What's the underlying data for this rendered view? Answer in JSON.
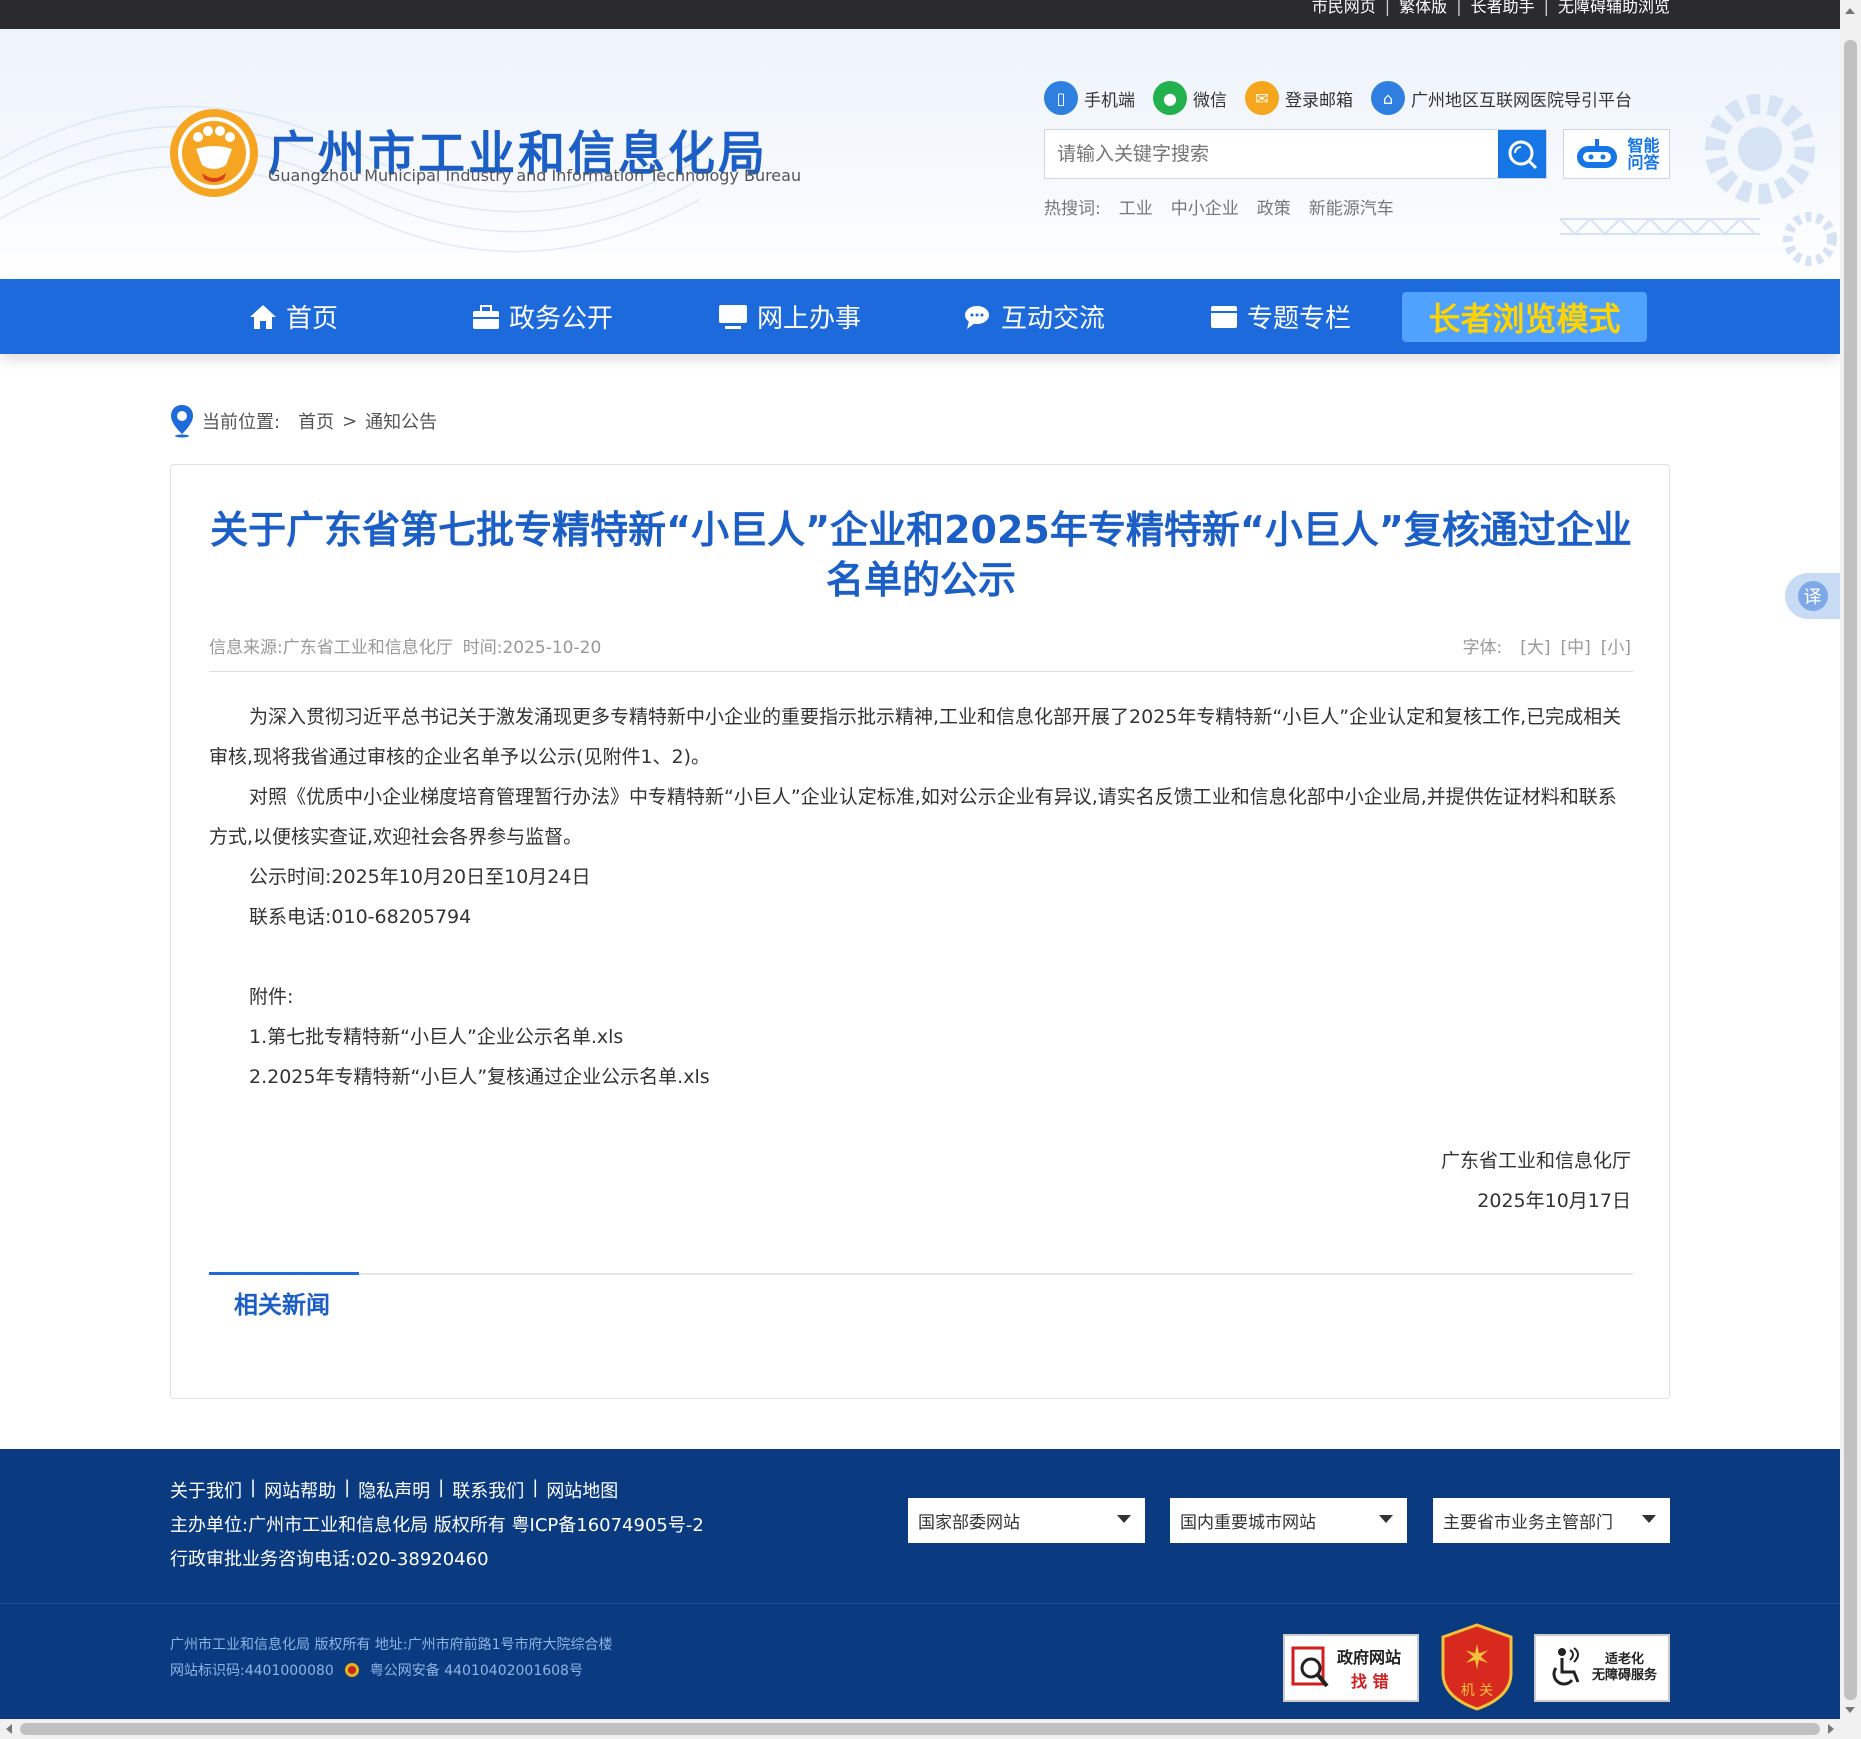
{
  "topbar": {
    "links": [
      "市民网页",
      "繁体版",
      "长者助手",
      "无障碍辅助浏览"
    ]
  },
  "header": {
    "title": "广州市工业和信息化局",
    "subtitle": "Guangzhou Municipal Industry and Information Technology Bureau",
    "quicklinks": [
      {
        "label": "手机端",
        "icon": "mobile-icon",
        "color": "#2e7fe0"
      },
      {
        "label": "微信",
        "icon": "wechat-icon",
        "color": "#23b14d"
      },
      {
        "label": "登录邮箱",
        "icon": "mail-icon",
        "color": "#f5a61c"
      },
      {
        "label": "广州地区互联网医院导引平台",
        "icon": "hospital-icon",
        "color": "#2e7fe0"
      }
    ],
    "search": {
      "placeholder": "请输入关键字搜索"
    },
    "robot": {
      "line1": "智能",
      "line2": "问答"
    },
    "hotwords_label": "热搜词:",
    "hotwords": [
      "工业",
      "中小企业",
      "政策",
      "新能源汽车"
    ]
  },
  "nav": {
    "items": [
      {
        "label": "首页",
        "icon": "home-icon"
      },
      {
        "label": "政务公开",
        "icon": "briefcase-icon"
      },
      {
        "label": "网上办事",
        "icon": "monitor-icon"
      },
      {
        "label": "互动交流",
        "icon": "chat-icon"
      },
      {
        "label": "专题专栏",
        "icon": "folder-icon"
      }
    ],
    "elder_mode": "长者浏览模式"
  },
  "breadcrumb": {
    "label": "当前位置:",
    "home": "首页",
    "sep": ">",
    "current": "通知公告"
  },
  "article": {
    "title": "关于广东省第七批专精特新“小巨人”企业和2025年专精特新“小巨人”复核通过企业名单的公示",
    "source": "信息来源:广东省工业和信息化厅",
    "time": "时间:2025-10-20",
    "font_label": "字体:",
    "font_sizes": [
      "[大]",
      "[中]",
      "[小]"
    ],
    "paragraphs": [
      "为深入贯彻习近平总书记关于激发涌现更多专精特新中小企业的重要指示批示精神,工业和信息化部开展了2025年专精特新“小巨人”企业认定和复核工作,已完成相关审核,现将我省通过审核的企业名单予以公示(见附件1、2)。",
      "对照《优质中小企业梯度培育管理暂行办法》中专精特新“小巨人”企业认定标准,如对公示企业有异议,请实名反馈工业和信息化部中小企业局,并提供佐证材料和联系方式,以便核实查证,欢迎社会各界参与监督。"
    ],
    "notice_period": "公示时间:2025年10月20日至10月24日",
    "phone": "联系电话:010-68205794",
    "attach_label": "附件:",
    "attachments": [
      "1.第七批专精特新“小巨人”企业公示名单.xls",
      "2.2025年专精特新“小巨人”复核通过企业公示名单.xls"
    ],
    "sign_org": "广东省工业和信息化厅",
    "sign_date": "2025年10月17日",
    "related": "相关新闻"
  },
  "translate": "译",
  "footer": {
    "links": [
      "关于我们",
      "网站帮助",
      "隐私声明",
      "联系我们",
      "网站地图"
    ],
    "host": "主办单位:广州市工业和信息化局 版权所有 粤ICP备16074905号-2",
    "hotline": "行政审批业务咨询电话:020-38920460",
    "selects": [
      "国家部委网站",
      "国内重要城市网站",
      "主要省市业务主管部门"
    ],
    "small1": "广州市工业和信息化局 版权所有 地址:广州市府前路1号市府大院综合楼",
    "site_code": "网站标识码:4401000080",
    "police": "粤公网安备 44010402001608号",
    "badge_find_error": {
      "line1": "政府网站",
      "line2": "找 错"
    },
    "badge_org": "机 关",
    "badge_access": {
      "line1": "适老化",
      "line2": "无障碍服务"
    }
  }
}
